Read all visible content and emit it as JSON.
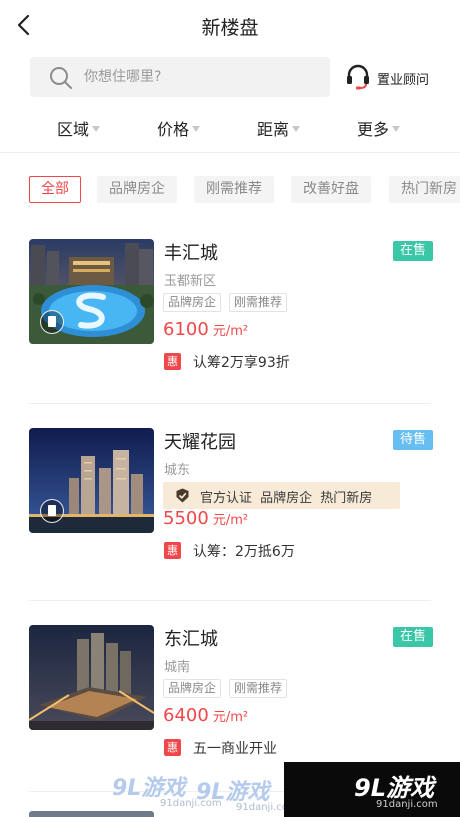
{
  "header": {
    "title": "新楼盘"
  },
  "search": {
    "placeholder": "你想住哪里?",
    "advisor_label": "置业顾问"
  },
  "filters": [
    "区域",
    "价格",
    "距离",
    "更多"
  ],
  "tags": [
    "全部",
    "品牌房企",
    "刚需推荐",
    "改善好盘",
    "热门新房"
  ],
  "listings": [
    {
      "name": "丰汇城",
      "status": "在售",
      "district": "玉都新区",
      "features": [
        "品牌房企",
        "刚需推荐"
      ],
      "price": "6100",
      "price_unit": "元/m²",
      "promo_badge": "惠",
      "promo": "认筹2万享93折"
    },
    {
      "name": "天耀花园",
      "status": "待售",
      "district": "城东",
      "official": "官方认证  品牌房企  热门新房",
      "price": "5500",
      "price_unit": "元/m²",
      "promo_badge": "惠",
      "promo": "认筹：2万抵6万"
    },
    {
      "name": "东汇城",
      "status": "在售",
      "district": "城南",
      "features": [
        "品牌房企",
        "刚需推荐"
      ],
      "price": "6400",
      "price_unit": "元/m²",
      "promo_badge": "惠",
      "promo": "五一商业开业"
    }
  ],
  "watermark": {
    "logo": "9L游戏",
    "url": "91danji.com"
  },
  "colors": {
    "accent_red": "#f0484a",
    "status_green": "#3ac7a7",
    "status_blue": "#66bff0",
    "official_bg": "#f7ead7"
  }
}
